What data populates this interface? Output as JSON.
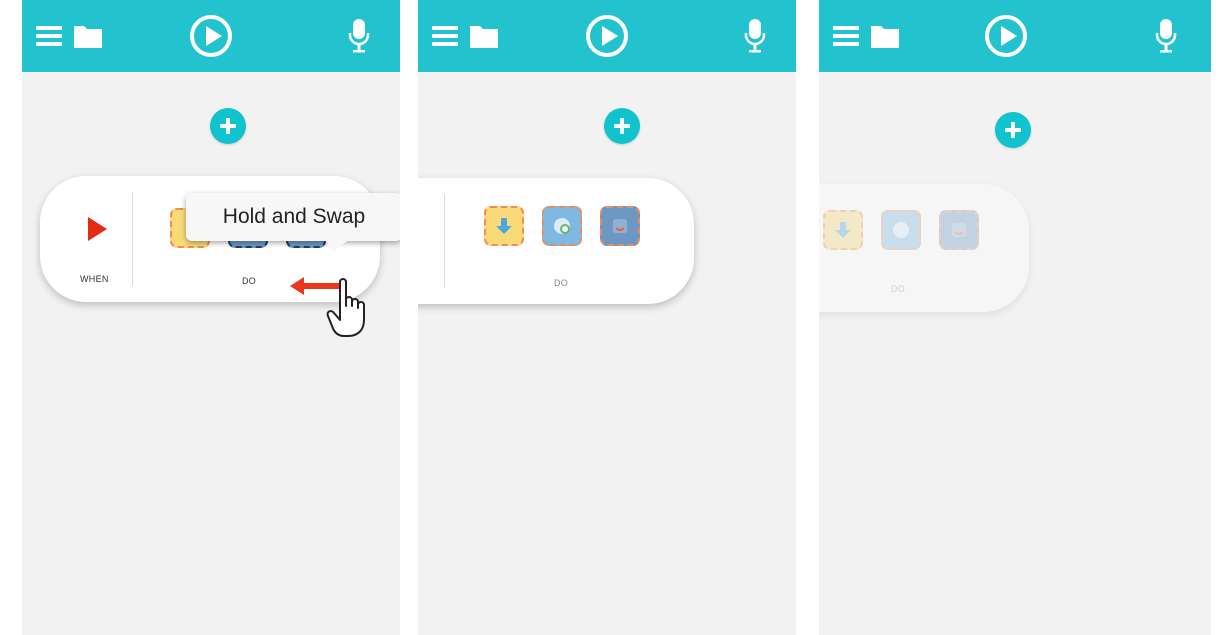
{
  "colors": {
    "accent": "#22c3cf",
    "play_trigger": "#e42b16",
    "swap_arrow": "#e8391c",
    "tile_border": "#f08a57"
  },
  "icons": {
    "menu": "menu-icon",
    "folder": "folder-icon",
    "play": "play-circle-icon",
    "mic": "microphone-icon",
    "add": "add-icon",
    "trigger": "play-triangle-icon",
    "hand": "hand-pointer-icon",
    "swap": "swap-arrow-icon"
  },
  "panels": [
    {
      "rule": {
        "when_label": "WHEN",
        "do_label": "DO"
      },
      "tooltip": "Hold and Swap"
    },
    {
      "rule": {
        "when_label": "",
        "do_label": "DO"
      }
    },
    {
      "rule": {
        "when_label": "",
        "do_label": "DO"
      }
    }
  ]
}
